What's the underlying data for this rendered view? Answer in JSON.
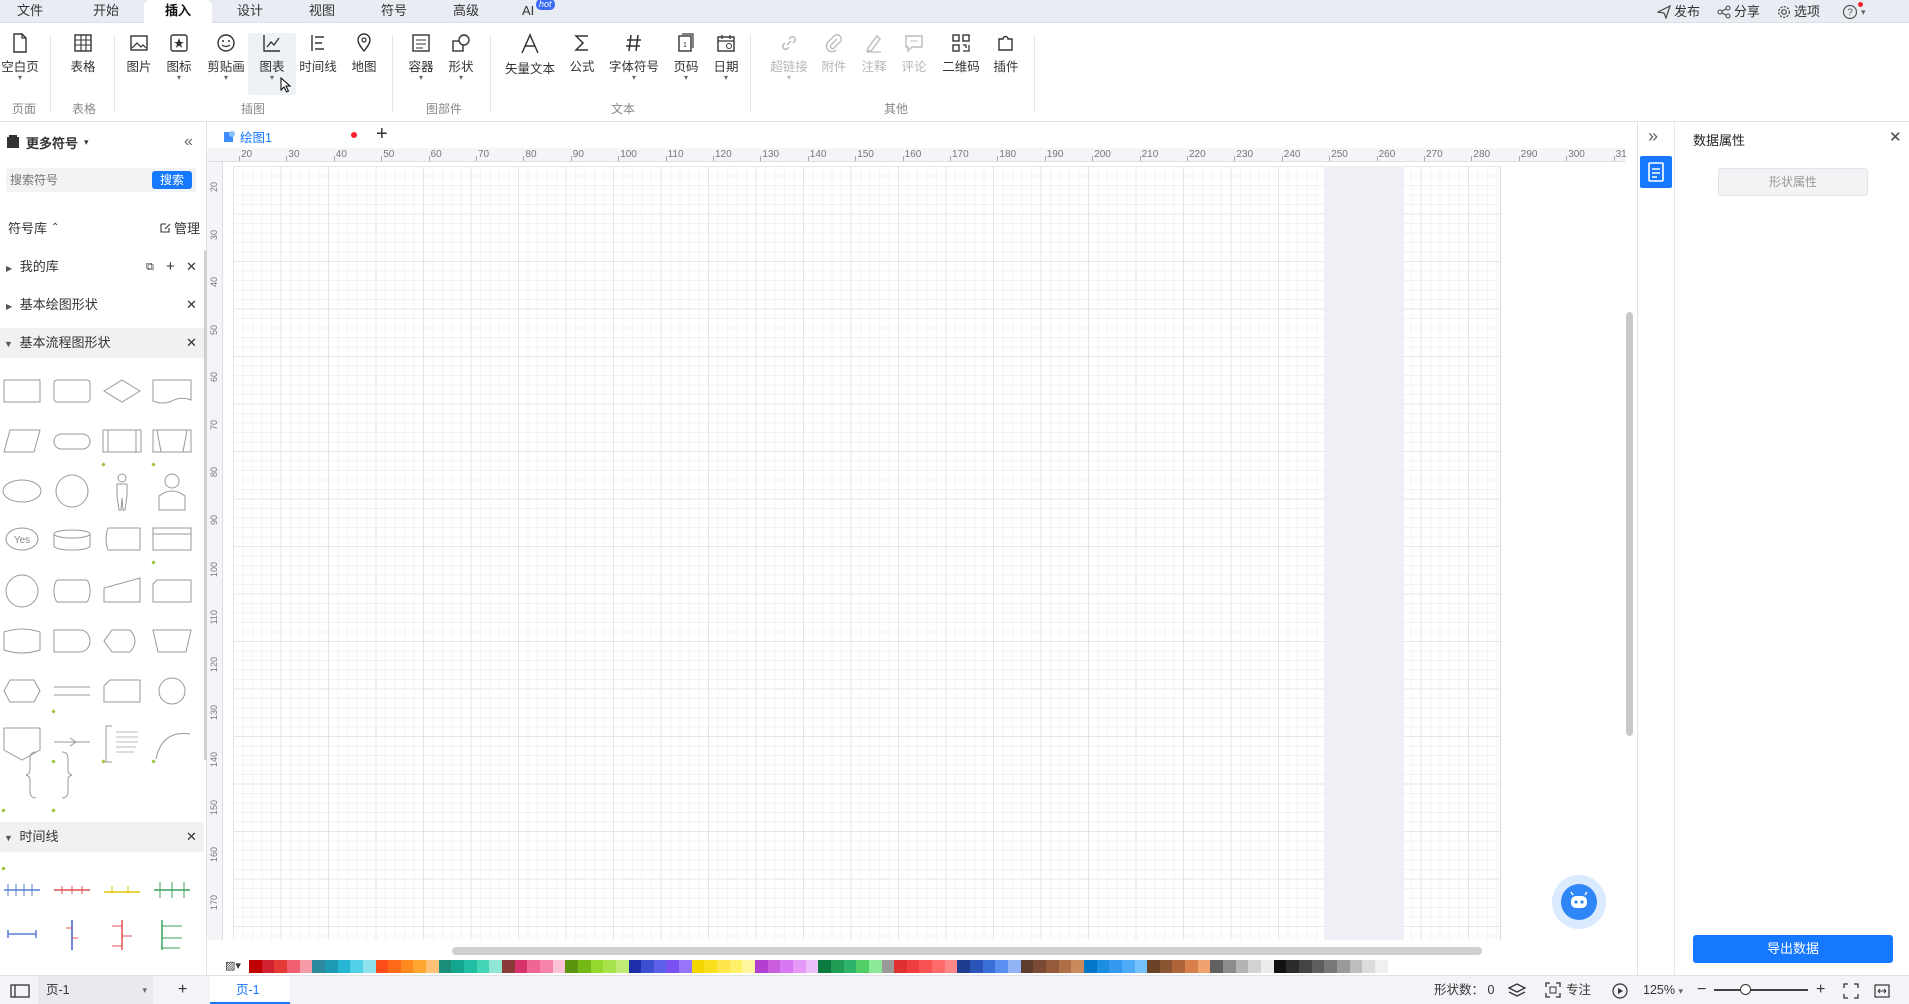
{
  "menu": {
    "tabs": [
      "文件",
      "开始",
      "插入",
      "设计",
      "视图",
      "符号",
      "高级",
      "AI"
    ],
    "active_tab": "插入",
    "hot_badge": "hot",
    "right": {
      "publish": "发布",
      "share": "分享",
      "options": "选项"
    }
  },
  "ribbon": {
    "buttons": [
      "空白页",
      "表格",
      "图片",
      "图标",
      "剪贴画",
      "图表",
      "时间线",
      "地图",
      "容器",
      "形状",
      "矢量文本",
      "公式",
      "字体符号",
      "页码",
      "日期",
      "超链接",
      "附件",
      "注释",
      "评论",
      "二维码",
      "插件"
    ],
    "groups": [
      "页面",
      "表格",
      "插图",
      "图部件",
      "文本",
      "其他"
    ]
  },
  "left_panel": {
    "title": "更多符号",
    "search_placeholder": "搜索符号",
    "search_button": "搜索",
    "library_label": "符号库",
    "manage_label": "管理",
    "my_library": "我的库",
    "basic_drawing": "基本绘图形状",
    "basic_flowchart": "基本流程图形状",
    "timeline": "时间线",
    "yes_shape_label": "Yes"
  },
  "document": {
    "tab_name": "绘图1",
    "page_name": "页-1",
    "ruler_h": [
      "20",
      "30",
      "40",
      "50",
      "60",
      "70",
      "80",
      "90",
      "100",
      "110",
      "120",
      "130",
      "140",
      "150",
      "160",
      "170",
      "180",
      "190",
      "200",
      "210",
      "220",
      "230",
      "240",
      "250",
      "260",
      "270",
      "280",
      "290",
      "300",
      "31"
    ],
    "ruler_v": [
      "20",
      "30",
      "40",
      "50",
      "60",
      "70",
      "80",
      "90",
      "100",
      "110",
      "120",
      "130",
      "140",
      "150",
      "160",
      "170"
    ]
  },
  "right_panel": {
    "title": "数据属性",
    "shape_props_button": "形状属性",
    "export_button": "导出数据"
  },
  "status": {
    "page_selector": "页-1",
    "page_tab": "页-1",
    "shape_count_label": "形状数：",
    "shape_count": "0",
    "focus_label": "专注",
    "zoom": "125%"
  },
  "colors": {
    "accent": "#1677ff",
    "palette": [
      "#c00000",
      "#d0222e",
      "#e53935",
      "#f06070",
      "#f59aa6",
      "#2b8a9e",
      "#1e9bb4",
      "#26b6d4",
      "#4fd0e6",
      "#8ee2f0",
      "#ff4d1a",
      "#ff6a1a",
      "#ff8a1f",
      "#ffa532",
      "#ffc077",
      "#1a8e7a",
      "#14a58e",
      "#20bfa3",
      "#44d4b8",
      "#8fe6d4",
      "#8b3a3a",
      "#d6336c",
      "#f06595",
      "#f783ac",
      "#fcc2d7",
      "#5c940d",
      "#74b816",
      "#94d82d",
      "#a9e34b",
      "#c0eb75",
      "#1c2fa8",
      "#3b4fd0",
      "#5c5fe8",
      "#7950f2",
      "#9775fa",
      "#f2d600",
      "#fadf1e",
      "#ffe64d",
      "#fff06a",
      "#fff59d",
      "#b43ecf",
      "#c95ddb",
      "#da77f2",
      "#e599f7",
      "#eebefa",
      "#0b7a3e",
      "#1f9d55",
      "#2fb36a",
      "#51cf66",
      "#8ce99a",
      "#9a9a9a",
      "#e03131",
      "#f03e3e",
      "#fa5252",
      "#ff6b6b",
      "#ff8787",
      "#1d3b8f",
      "#2a54b8",
      "#3b6fd8",
      "#5a8ef0",
      "#8fb3f5",
      "#5c3d2e",
      "#7a4a34",
      "#945a3c",
      "#ad6e48",
      "#c98a5e",
      "#0077c8",
      "#1c8ee0",
      "#339af0",
      "#4dabf7",
      "#74c0fc",
      "#6b4226",
      "#8a5533",
      "#b0643a",
      "#d9804a",
      "#f0a36e",
      "#606060",
      "#8c8c8c",
      "#b4b4b4",
      "#d2d2d2",
      "#ececec",
      "#111111",
      "#2b2b2b",
      "#444444",
      "#5e5e5e",
      "#787878",
      "#9a9a9a",
      "#bdbdbd",
      "#dcdcdc",
      "#f0f0f0"
    ]
  }
}
